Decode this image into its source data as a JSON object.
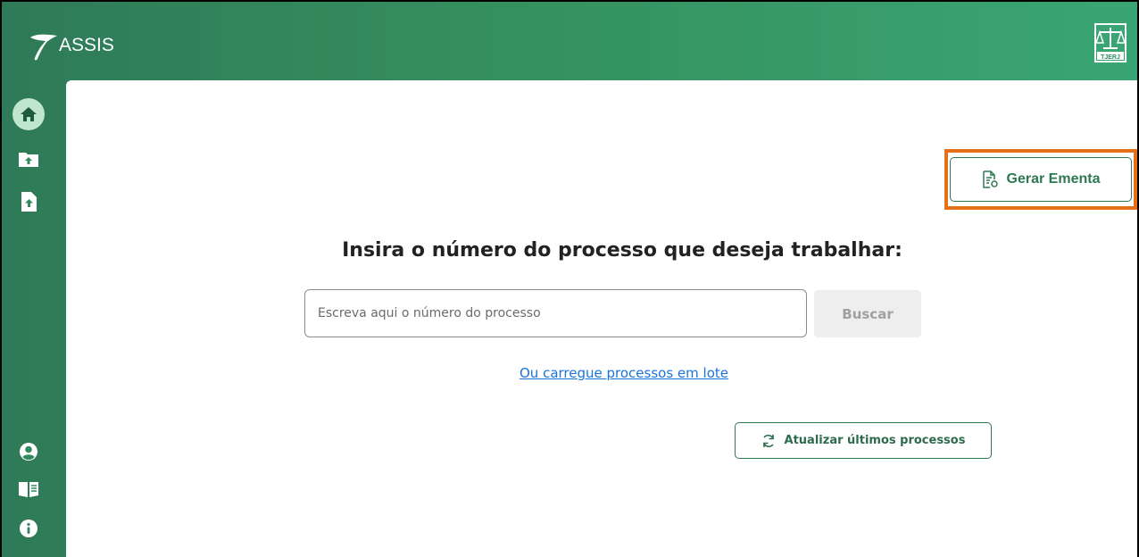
{
  "app": {
    "name": "ASSIS",
    "org_badge": "TJERJ"
  },
  "colors": {
    "primary": "#2d7a52",
    "header_gradient_start": "#2f7a58",
    "header_gradient_end": "#3aa574",
    "highlight": "#e5701a",
    "link": "#1a73d9"
  },
  "sidebar": {
    "top_items": [
      {
        "name": "home",
        "icon": "home-icon",
        "active": true
      },
      {
        "name": "upload-folder",
        "icon": "folder-upload-icon",
        "active": false
      },
      {
        "name": "upload-file",
        "icon": "file-upload-icon",
        "active": false
      }
    ],
    "bottom_items": [
      {
        "name": "profile",
        "icon": "user-circle-icon"
      },
      {
        "name": "manual",
        "icon": "book-icon"
      },
      {
        "name": "info",
        "icon": "info-icon"
      }
    ]
  },
  "main": {
    "gerar_ementa_label": "Gerar Ementa",
    "headline": "Insira o número do processo que deseja trabalhar:",
    "search_placeholder": "Escreva aqui o número do processo",
    "search_value": "",
    "buscar_label": "Buscar",
    "lote_link": "Ou carregue processos em lote",
    "atualizar_label": "Atualizar últimos processos"
  }
}
